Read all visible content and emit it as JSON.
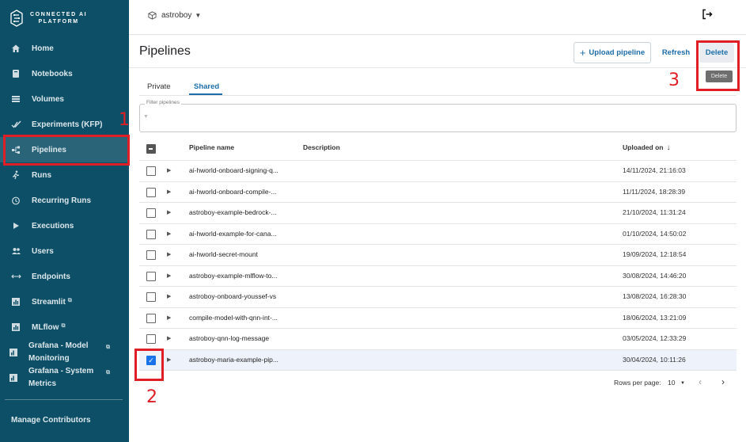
{
  "brand": {
    "line1": "CONNECTED AI",
    "line2": "PLATFORM"
  },
  "sidebar": {
    "items": [
      {
        "label": "Home",
        "icon": "home-icon"
      },
      {
        "label": "Notebooks",
        "icon": "notebook-icon"
      },
      {
        "label": "Volumes",
        "icon": "storage-icon"
      },
      {
        "label": "Experiments (KFP)",
        "icon": "checks-icon"
      },
      {
        "label": "Pipelines",
        "icon": "flow-icon"
      },
      {
        "label": "Runs",
        "icon": "running-icon"
      },
      {
        "label": "Recurring Runs",
        "icon": "alarm-icon"
      },
      {
        "label": "Executions",
        "icon": "play-icon"
      },
      {
        "label": "Users",
        "icon": "users-icon"
      },
      {
        "label": "Endpoints",
        "icon": "arrows-icon"
      },
      {
        "label": "Streamlit",
        "icon": "chart-icon"
      },
      {
        "label": "MLflow",
        "icon": "chart-icon"
      },
      {
        "label": "Grafana - Model Monitoring",
        "icon": "grafana-icon"
      },
      {
        "label": "Grafana - System Metrics",
        "icon": "grafana-icon"
      }
    ],
    "manage_label": "Manage Contributors",
    "external_glyph": "⧉"
  },
  "topbar": {
    "namespace": "astroboy"
  },
  "header": {
    "title": "Pipelines",
    "upload_label": "Upload pipeline",
    "refresh_label": "Refresh",
    "delete_label": "Delete",
    "tooltip": "Delete"
  },
  "tabs": {
    "private": "Private",
    "shared": "Shared"
  },
  "filter": {
    "label": "Filter pipelines"
  },
  "table": {
    "columns": {
      "name": "Pipeline name",
      "description": "Description",
      "uploaded": "Uploaded on"
    },
    "rows": [
      {
        "name": "ai-hworld-onboard-signing-q...",
        "date": "14/11/2024, 21:16:03",
        "checked": false
      },
      {
        "name": "ai-hworld-onboard-compile-...",
        "date": "11/11/2024, 18:28:39",
        "checked": false
      },
      {
        "name": "astroboy-example-bedrock-...",
        "date": "21/10/2024, 11:31:24",
        "checked": false
      },
      {
        "name": "ai-hworld-example-for-cana...",
        "date": "01/10/2024, 14:50:02",
        "checked": false
      },
      {
        "name": "ai-hworld-secret-mount",
        "date": "19/09/2024, 12:18:54",
        "checked": false
      },
      {
        "name": "astroboy-example-mlflow-to...",
        "date": "30/08/2024, 14:46:20",
        "checked": false
      },
      {
        "name": "astroboy-onboard-youssef-vs",
        "date": "13/08/2024, 16:28:30",
        "checked": false
      },
      {
        "name": "compile-model-with-qnn-int-...",
        "date": "18/06/2024, 13:21:09",
        "checked": false
      },
      {
        "name": "astroboy-qnn-log-message",
        "date": "03/05/2024, 12:33:29",
        "checked": false
      },
      {
        "name": "astroboy-maria-example-pip...",
        "date": "30/04/2024, 10:11:26",
        "checked": true
      }
    ]
  },
  "pagination": {
    "label": "Rows per page:",
    "value": "10"
  },
  "annotations": {
    "one": "1",
    "two": "2",
    "three": "3",
    "color": "#e01e25"
  },
  "colors": {
    "sidebar": "#0d4f66",
    "accent": "#1d6ea8"
  }
}
